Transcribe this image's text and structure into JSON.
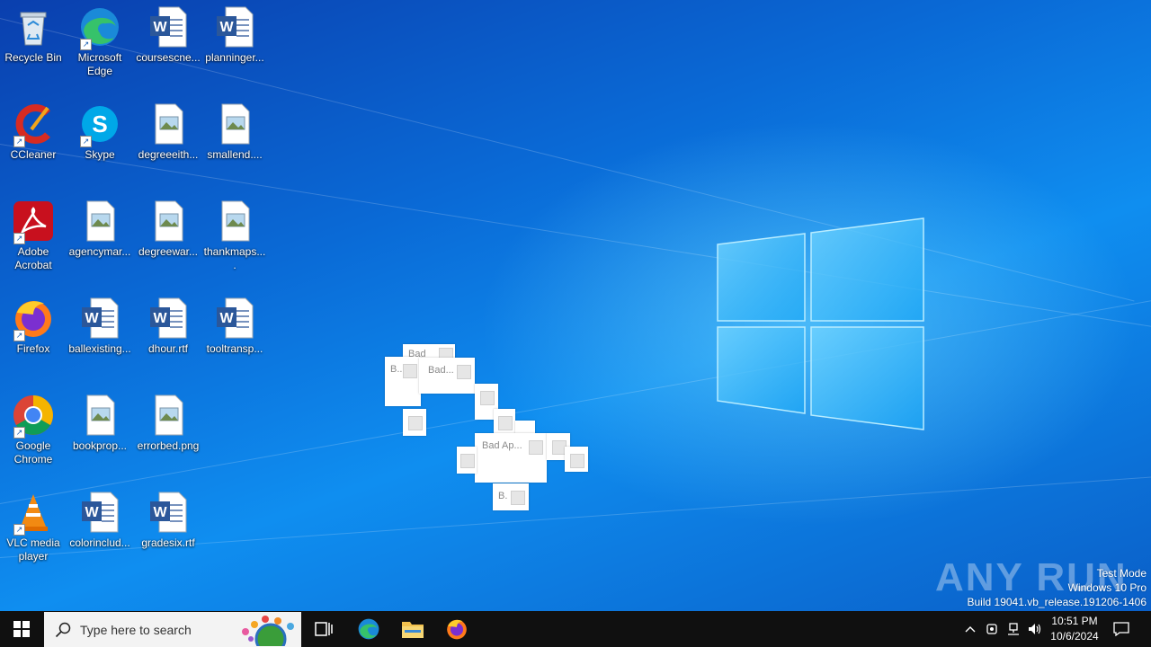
{
  "desktop": {
    "icons": [
      {
        "name": "Recycle Bin",
        "icon": "recycle-bin-icon"
      },
      {
        "name": "Microsoft Edge",
        "icon": "edge-icon"
      },
      {
        "name": "coursescne...",
        "icon": "word-doc-icon"
      },
      {
        "name": "planninger...",
        "icon": "word-doc-icon"
      },
      {
        "name": "CCleaner",
        "icon": "ccleaner-icon"
      },
      {
        "name": "Skype",
        "icon": "skype-icon"
      },
      {
        "name": "degreeeith...",
        "icon": "image-file-icon"
      },
      {
        "name": "smallend....",
        "icon": "image-file-icon"
      },
      {
        "name": "Adobe Acrobat",
        "icon": "acrobat-icon"
      },
      {
        "name": "agencymar...",
        "icon": "image-file-icon"
      },
      {
        "name": "degreewar...",
        "icon": "image-file-icon"
      },
      {
        "name": "thankmaps....",
        "icon": "image-file-icon"
      },
      {
        "name": "Firefox",
        "icon": "firefox-icon"
      },
      {
        "name": "ballexisting...",
        "icon": "word-doc-icon"
      },
      {
        "name": "dhour.rtf",
        "icon": "word-doc-icon"
      },
      {
        "name": "tooltransp...",
        "icon": "word-doc-icon"
      },
      {
        "name": "Google Chrome",
        "icon": "chrome-icon"
      },
      {
        "name": "bookprop...",
        "icon": "image-file-icon"
      },
      {
        "name": "errorbed.png",
        "icon": "image-file-icon"
      },
      {
        "name": "VLC media player",
        "icon": "vlc-icon"
      },
      {
        "name": "colorinclud...",
        "icon": "word-doc-icon"
      },
      {
        "name": "gradesix.rtf",
        "icon": "word-doc-icon"
      }
    ]
  },
  "popups": {
    "titles": [
      "Bad",
      "B...",
      "Bad...",
      "Bad Ap...",
      "B."
    ]
  },
  "watermark": {
    "brand": "ANY RUN",
    "test_mode": "Test Mode",
    "edition": "Windows 10 Pro",
    "build": "Build 19041.vb_release.191206-1406"
  },
  "taskbar": {
    "search_placeholder": "Type here to search",
    "time": "10:51 PM",
    "date": "10/6/2024"
  },
  "colors": {
    "taskbar": "#101010",
    "wallpaper_accent": "#0f8ef0"
  }
}
